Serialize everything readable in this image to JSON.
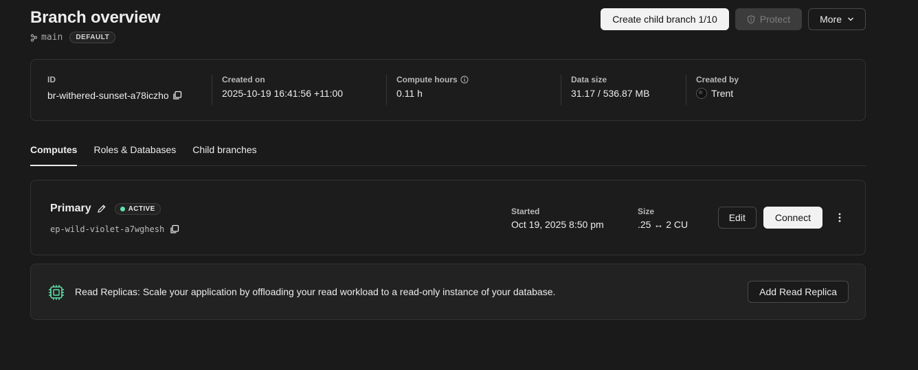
{
  "header": {
    "title": "Branch overview",
    "branch_name": "main",
    "branch_badge": "DEFAULT",
    "create_child_label": "Create child branch 1/10",
    "protect_label": "Protect",
    "more_label": "More"
  },
  "info": {
    "id_label": "ID",
    "id_value": "br-withered-sunset-a78iczho",
    "created_on_label": "Created on",
    "created_on_value": "2025-10-19 16:41:56 +11:00",
    "compute_hours_label": "Compute hours",
    "compute_hours_value": "0.11 h",
    "data_size_label": "Data size",
    "data_size_value": "31.17 / 536.87 MB",
    "created_by_label": "Created by",
    "created_by_value": "Trent"
  },
  "tabs": [
    {
      "label": "Computes",
      "active": true
    },
    {
      "label": "Roles & Databases",
      "active": false
    },
    {
      "label": "Child branches",
      "active": false
    }
  ],
  "compute": {
    "name": "Primary",
    "status": "ACTIVE",
    "endpoint": "ep-wild-violet-a7wghesh",
    "started_label": "Started",
    "started_value": "Oct 19, 2025 8:50 pm",
    "size_label": "Size",
    "size_value": ".25 ↔ 2 CU",
    "edit_label": "Edit",
    "connect_label": "Connect"
  },
  "replica": {
    "text": "Read Replicas: Scale your application by offloading your read workload to a read-only instance of your database.",
    "button_label": "Add Read Replica"
  },
  "colors": {
    "background": "#1a1a1a",
    "accent": "#5ee3ae"
  }
}
